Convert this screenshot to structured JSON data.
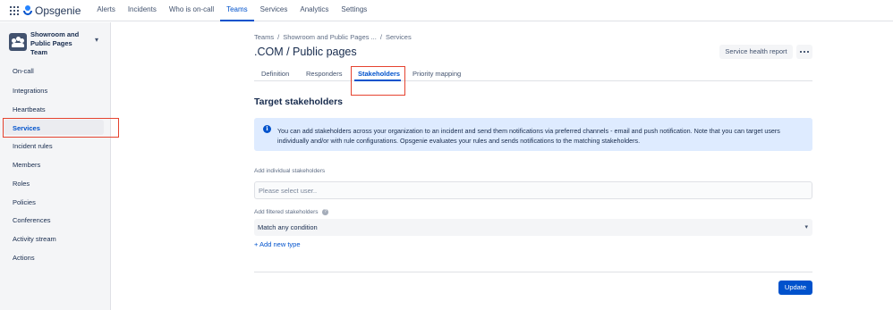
{
  "topnav": {
    "app_name": "Opsgenie",
    "items": [
      {
        "label": "Alerts"
      },
      {
        "label": "Incidents"
      },
      {
        "label": "Who is on-call"
      },
      {
        "label": "Teams",
        "active": true
      },
      {
        "label": "Services"
      },
      {
        "label": "Analytics"
      },
      {
        "label": "Settings"
      }
    ]
  },
  "sidebar": {
    "team_name": "Showroom and Public Pages Team",
    "items": [
      {
        "label": "On-call"
      },
      {
        "label": "Integrations"
      },
      {
        "label": "Heartbeats"
      },
      {
        "label": "Services",
        "active": true
      },
      {
        "label": "Incident rules"
      },
      {
        "label": "Members"
      },
      {
        "label": "Roles"
      },
      {
        "label": "Policies"
      },
      {
        "label": "Conferences"
      },
      {
        "label": "Activity stream"
      },
      {
        "label": "Actions"
      }
    ]
  },
  "breadcrumb": [
    "Teams",
    "Showroom and Public Pages ...",
    "Services"
  ],
  "page": {
    "title": ".COM / Public pages",
    "service_health_report_label": "Service health report"
  },
  "tabs": [
    {
      "label": "Definition"
    },
    {
      "label": "Responders"
    },
    {
      "label": "Stakeholders",
      "active": true
    },
    {
      "label": "Priority mapping"
    }
  ],
  "stakeholders": {
    "section_title": "Target stakeholders",
    "info_text": "You can add stakeholders across your organization to an incident and send them notifications via preferred channels - email and push notification. Note that you can target users individually and/or with rule configurations. Opsgenie evaluates your rules and sends notifications to the matching stakeholders.",
    "individual_label": "Add individual stakeholders",
    "user_placeholder": "Please select user..",
    "filtered_label": "Add filtered stakeholders",
    "condition_value": "Match any condition",
    "add_type_label": "+ Add new type",
    "update_label": "Update"
  },
  "colors": {
    "accent": "#0052cc",
    "highlight": "#e5432f",
    "info_bg": "#deebff"
  }
}
